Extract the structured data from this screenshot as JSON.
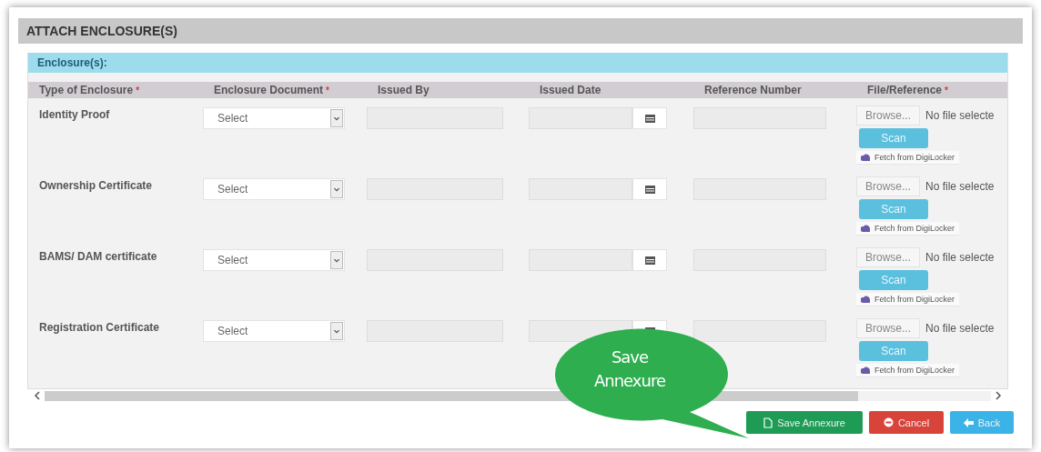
{
  "section_title": "ATTACH ENCLOSURE(S)",
  "panel_title": "Enclosure(s):",
  "columns": [
    {
      "label": "Type of Enclosure",
      "required_mark": "*"
    },
    {
      "label": "Enclosure Document",
      "required_mark": "*"
    },
    {
      "label": "Issued By"
    },
    {
      "label": "Issued Date"
    },
    {
      "label": "Reference Number"
    },
    {
      "label": "File/Reference",
      "required_mark": "*"
    }
  ],
  "rows": [
    {
      "type": "Identity Proof",
      "document": "Select",
      "browse": "Browse...",
      "file_status": "No file selecte",
      "scan": "Scan",
      "fetch": "Fetch from DigiLocker"
    },
    {
      "type": "Ownership Certificate",
      "document": "Select",
      "browse": "Browse...",
      "file_status": "No file selecte",
      "scan": "Scan",
      "fetch": "Fetch from DigiLocker"
    },
    {
      "type": "BAMS/ DAM certificate",
      "document": "Select",
      "browse": "Browse...",
      "file_status": "No file selecte",
      "scan": "Scan",
      "fetch": "Fetch from DigiLocker"
    },
    {
      "type": "Registration Certificate",
      "document": "Select",
      "browse": "Browse...",
      "file_status": "No file selecte",
      "scan": "Scan",
      "fetch": "Fetch from DigiLocker"
    }
  ],
  "callout": {
    "text": "Save Annexure"
  },
  "buttons": [
    {
      "kind": "save",
      "label": "Save Annexure"
    },
    {
      "kind": "cancel",
      "label": "Cancel"
    },
    {
      "kind": "back",
      "label": "Back"
    }
  ]
}
